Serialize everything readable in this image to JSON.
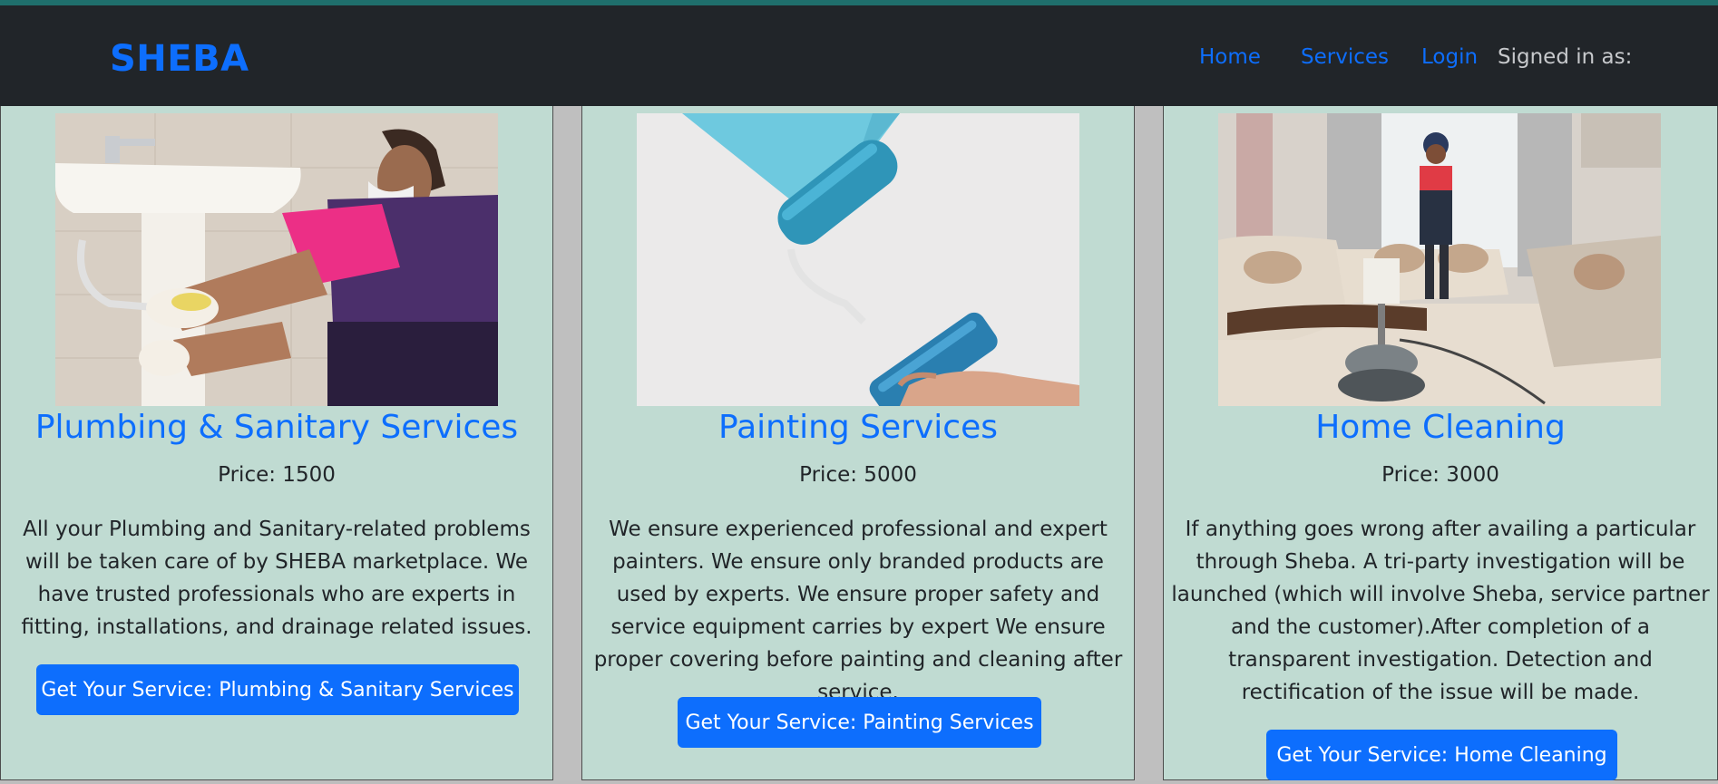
{
  "header": {
    "brand": "SHEBA",
    "nav": {
      "home": "Home",
      "services": "Services",
      "login": "Login"
    },
    "signed_in_label": "Signed in as:"
  },
  "services": [
    {
      "title": "Plumbing & Sanitary Services",
      "price": "Price: 1500",
      "description": "All your Plumbing and Sanitary-related problems will be taken care of by SHEBA marketplace. We have trusted professionals who are experts in fitting, installations, and drainage related issues.",
      "button": "Get Your Service: Plumbing & Sanitary Services"
    },
    {
      "title": "Painting Services",
      "price": "Price: 5000",
      "description": "We ensure experienced professional and expert painters. We ensure only branded products are used by experts. We ensure proper safety and service equipment carries by expert We ensure proper covering before painting and cleaning after service.",
      "button": "Get Your Service: Painting Services"
    },
    {
      "title": "Home Cleaning",
      "price": "Price: 3000",
      "description": "If anything goes wrong after availing a particular through Sheba. A tri-party investigation will be launched (which will involve Sheba, service partner and the customer).After completion of a transparent investigation. Detection and rectification of the issue will be made.",
      "button": "Get Your Service: Home Cleaning"
    }
  ],
  "colors": {
    "navbar_bg": "#212529",
    "accent": "#0d6efd",
    "card_bg": "#c0dbd2",
    "top_line": "#1f6f6c"
  }
}
